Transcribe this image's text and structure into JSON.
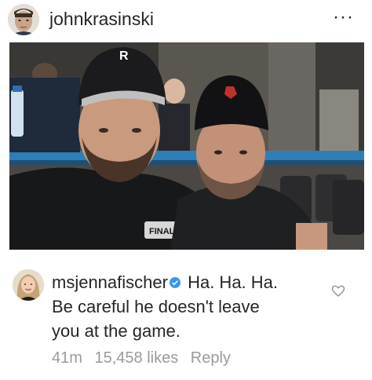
{
  "post": {
    "author_username": "johnkrasinski",
    "more_glyph": "···",
    "photo": {
      "cap_logo_left": "R",
      "shirt_text": "FINAL"
    }
  },
  "comment": {
    "username": "msjennafischer",
    "text_line1": "Ha. Ha. Ha.",
    "text_line2": "Be careful he doesn't leave",
    "text_line3": "you at the game.",
    "time": "41m",
    "likes": "15,458 likes",
    "reply": "Reply"
  },
  "colors": {
    "verified": "#3897f0",
    "meta": "#9a9a9a"
  },
  "icons": [
    "more-icon",
    "sound-icon",
    "verified-badge-icon",
    "heart-icon"
  ]
}
